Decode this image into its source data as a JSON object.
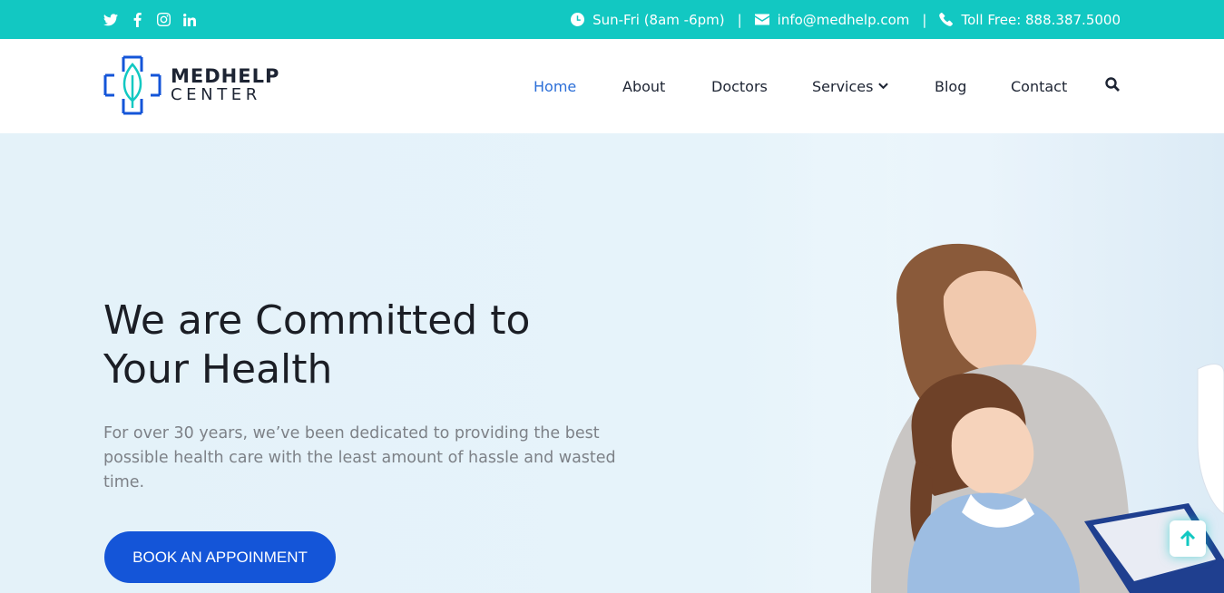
{
  "topbar": {
    "social": [
      "twitter-icon",
      "facebook-icon",
      "instagram-icon",
      "linkedin-icon"
    ],
    "hours": "Sun-Fri (8am -6pm)",
    "email": "info@medhelp.com",
    "phone": "Toll Free: 888.387.5000",
    "separator": "|"
  },
  "brand": {
    "line1": "MEDHELP",
    "line2": "CENTER"
  },
  "nav": {
    "home": "Home",
    "about": "About",
    "doctors": "Doctors",
    "services": "Services",
    "blog": "Blog",
    "contact": "Contact"
  },
  "hero": {
    "heading_line1": "We are Committed to",
    "heading_line2": "Your Health",
    "text": "For over 30 years, we’ve been dedicated to providing the best possible health care with the least amount of hassle and wasted time.",
    "cta": "BOOK AN APPOINMENT"
  },
  "colors": {
    "topbar": "#12c8c2",
    "accent_blue": "#1455d8",
    "nav_active": "#2c6fd8"
  }
}
